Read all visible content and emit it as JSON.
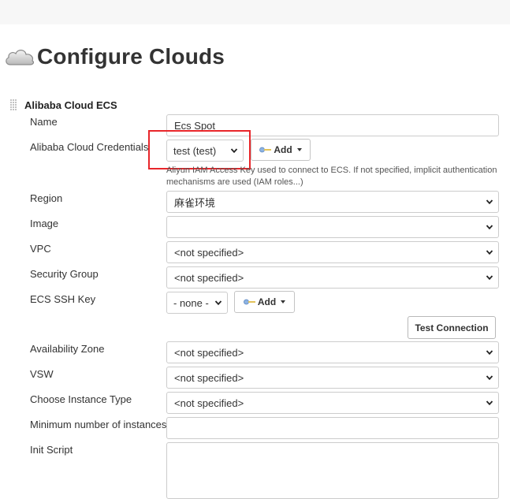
{
  "page": {
    "title": "Configure Clouds"
  },
  "section": {
    "title": "Alibaba Cloud ECS"
  },
  "fields": {
    "name": {
      "label": "Name",
      "value": "Ecs Spot"
    },
    "credentials": {
      "label": "Alibaba Cloud Credentials",
      "value": "test (test)",
      "add_label": "Add",
      "help": "Aliyun IAM Access Key used to connect to ECS. If not specified, implicit authentication mechanisms are used (IAM roles...)"
    },
    "region": {
      "label": "Region",
      "value": "麻雀环境"
    },
    "image": {
      "label": "Image",
      "value": ""
    },
    "vpc": {
      "label": "VPC",
      "value": "<not specified>"
    },
    "security_group": {
      "label": "Security Group",
      "value": "<not specified>"
    },
    "ssh_key": {
      "label": "ECS SSH Key",
      "value": "- none -",
      "add_label": "Add"
    },
    "test_connection": {
      "label": "Test Connection"
    },
    "availability_zone": {
      "label": "Availability Zone",
      "value": "<not specified>"
    },
    "vsw": {
      "label": "VSW",
      "value": "<not specified>"
    },
    "instance_type": {
      "label": "Choose Instance Type",
      "value": "<not specified>"
    },
    "min_instances": {
      "label": "Minimum number of instances",
      "value": ""
    },
    "init_script": {
      "label": "Init Script",
      "value": ""
    }
  },
  "colors": {
    "highlight": "#e8262a",
    "border": "#cccccc",
    "topbar": "#f7f7f7"
  },
  "icons": {
    "cloud": "cloud-icon",
    "key": "key-icon",
    "chevron": "chevron-down-icon",
    "drag": "drag-handle-icon"
  }
}
